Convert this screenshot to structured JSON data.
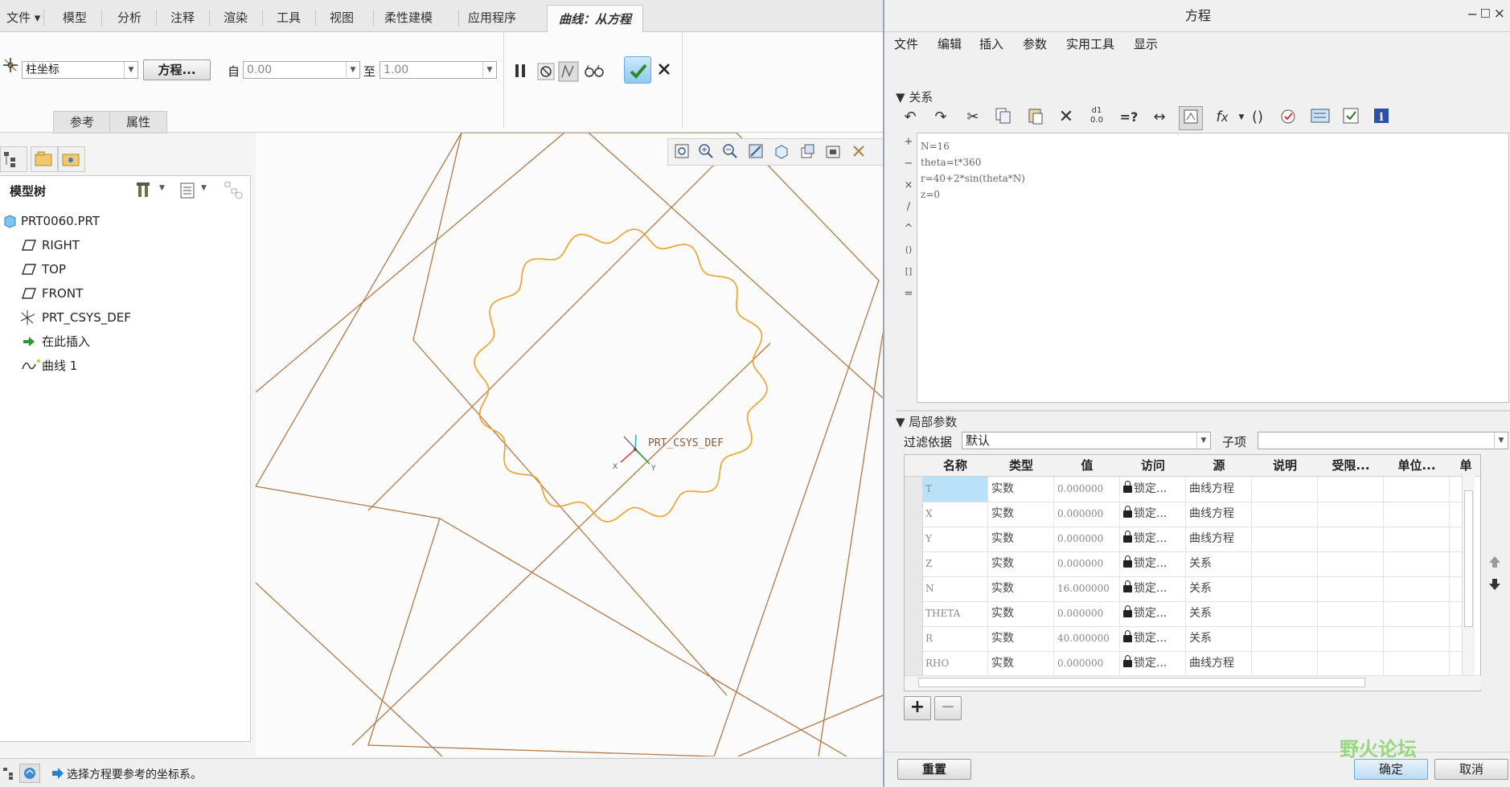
{
  "ribbon": {
    "tabs": [
      {
        "label": "文件"
      },
      {
        "label": "模型"
      },
      {
        "label": "分析"
      },
      {
        "label": "注释"
      },
      {
        "label": "渲染"
      },
      {
        "label": "工具"
      },
      {
        "label": "视图"
      },
      {
        "label": "柔性建模"
      },
      {
        "label": "应用程序"
      }
    ],
    "active_tab": "曲线：从方程",
    "coord_type": "柱坐标",
    "equation_button": "方程...",
    "from_label": "自",
    "from_value": "0.00",
    "to_label": "至",
    "to_value": "1.00",
    "subtabs": [
      "参考",
      "属性"
    ]
  },
  "tree": {
    "title": "模型树",
    "items": [
      {
        "label": "PRT0060.PRT",
        "icon": "part-icon"
      },
      {
        "label": "RIGHT",
        "icon": "datum-plane-icon"
      },
      {
        "label": "TOP",
        "icon": "datum-plane-icon"
      },
      {
        "label": "FRONT",
        "icon": "datum-plane-icon"
      },
      {
        "label": "PRT_CSYS_DEF",
        "icon": "csys-icon"
      },
      {
        "label": "在此插入",
        "icon": "insert-arrow-icon"
      },
      {
        "label": "曲线 1",
        "icon": "curve-icon"
      }
    ]
  },
  "viewport": {
    "csys_label": "PRT_CSYS_DEF",
    "axis_x": "X",
    "axis_y": "Y"
  },
  "status": {
    "message": "选择方程要参考的坐标系。"
  },
  "dialog": {
    "title": "方程",
    "window_controls": [
      "−",
      "□",
      "×"
    ],
    "menu": [
      "文件",
      "编辑",
      "插入",
      "参数",
      "实用工具",
      "显示"
    ],
    "relations_header": "关系",
    "relations": [
      "N=16",
      "theta=t*360",
      "r=40+2*sin(theta*N)",
      "z=0"
    ],
    "side_ops": [
      "+",
      "−",
      "×",
      "/",
      "^",
      "()",
      "[]",
      "="
    ],
    "local_params_header": "局部参数",
    "filter_label": "过滤依据",
    "filter_value": "默认",
    "subitem_label": "子项",
    "columns": [
      "名称",
      "类型",
      "值",
      "访问",
      "源",
      "说明",
      "受限...",
      "单位...",
      "单"
    ],
    "rows": [
      {
        "name": "T",
        "type": "实数",
        "value": "0.000000",
        "access": "锁定...",
        "source": "曲线方程"
      },
      {
        "name": "X",
        "type": "实数",
        "value": "0.000000",
        "access": "锁定...",
        "source": "曲线方程"
      },
      {
        "name": "Y",
        "type": "实数",
        "value": "0.000000",
        "access": "锁定...",
        "source": "曲线方程"
      },
      {
        "name": "Z",
        "type": "实数",
        "value": "0.000000",
        "access": "锁定...",
        "source": "关系"
      },
      {
        "name": "N",
        "type": "实数",
        "value": "16.000000",
        "access": "锁定...",
        "source": "关系"
      },
      {
        "name": "THETA",
        "type": "实数",
        "value": "0.000000",
        "access": "锁定...",
        "source": "关系"
      },
      {
        "name": "R",
        "type": "实数",
        "value": "40.000000",
        "access": "锁定...",
        "source": "关系"
      },
      {
        "name": "RHO",
        "type": "实数",
        "value": "0.000000",
        "access": "锁定...",
        "source": "曲线方程"
      }
    ],
    "reset_button": "重置",
    "ok_button": "确定",
    "cancel_button": "取消",
    "watermark": "野火论坛"
  },
  "colors": {
    "accent": "#3d8f3d",
    "curve": "#f0a028",
    "datum": "#b47846",
    "selection": "#b9e1f7"
  }
}
